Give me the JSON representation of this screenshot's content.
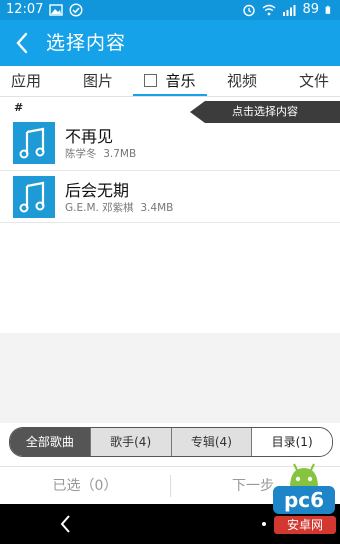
{
  "status_bar": {
    "time": "12:07",
    "battery": "89"
  },
  "header": {
    "title": "选择内容"
  },
  "tabs": [
    {
      "label": "应用"
    },
    {
      "label": "图片"
    },
    {
      "label": "音乐"
    },
    {
      "label": "视频"
    },
    {
      "label": "文件"
    }
  ],
  "list": {
    "section_index": "#",
    "hint": "点击选择内容",
    "items": [
      {
        "title": "不再见",
        "artist": "陈学冬",
        "size": "3.7MB"
      },
      {
        "title": "后会无期",
        "artist": "G.E.M. 邓紫棋",
        "size": "3.4MB"
      }
    ]
  },
  "filters": [
    {
      "label": "全部歌曲"
    },
    {
      "label": "歌手(4)"
    },
    {
      "label": "专辑(4)"
    },
    {
      "label": "目录(1)"
    }
  ],
  "bottom": {
    "selected_label": "已选（0）",
    "next_label": "下一步"
  },
  "watermark": {
    "brand": "pc6",
    "sub": "安卓网"
  },
  "colors": {
    "accent": "#16a2e8",
    "music_icon_bg": "#1e9bd7",
    "segment_active": "#555555"
  }
}
